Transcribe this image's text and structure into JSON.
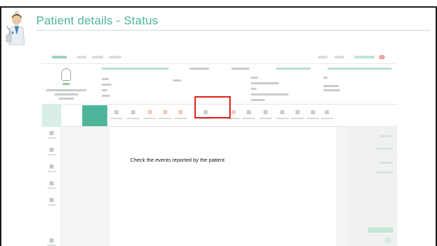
{
  "slide": {
    "title": "Patient details - Status",
    "caption": "Check the events reported by the patient"
  },
  "colors": {
    "title": "#4fb59a",
    "accent": "#4fb59a",
    "highlight": "#e0201b",
    "frame": "#1a1a1a"
  },
  "icons": {
    "presenter": "doctor-avatar-icon",
    "patient": "patient-avatar-icon"
  }
}
